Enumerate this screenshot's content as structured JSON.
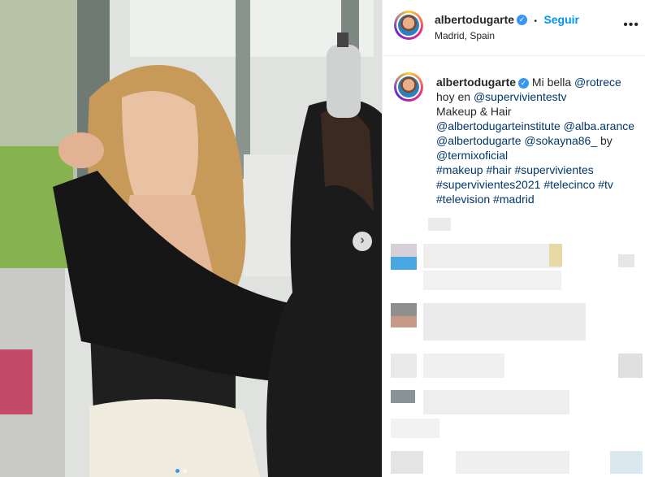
{
  "post": {
    "username": "albertodugarte",
    "follow_label": "Seguir",
    "location": "Madrid, Spain",
    "more_icon": "more-horizontal-icon",
    "verified_icon": "verified-badge-icon"
  },
  "caption": {
    "username": "albertodugarte",
    "lines": [
      "Mi bella @rotrece",
      "hoy en @supervivientestv",
      "Makeup & Hair",
      "@albertodugarteinstitute @alba.arance",
      "@albertodugarte @sokayna86_ by",
      "@termixoficial",
      "#makeup #hair #supervivientes",
      "#supervivientes2021 #telecinco #tv",
      "#television #madrid"
    ]
  },
  "carousel": {
    "next_icon": "chevron-right-icon",
    "total_pages": 2,
    "current_page": 1
  },
  "colors": {
    "accent": "#0095f6",
    "verified": "#3897f0",
    "text": "#262626",
    "mention": "#00376b"
  }
}
